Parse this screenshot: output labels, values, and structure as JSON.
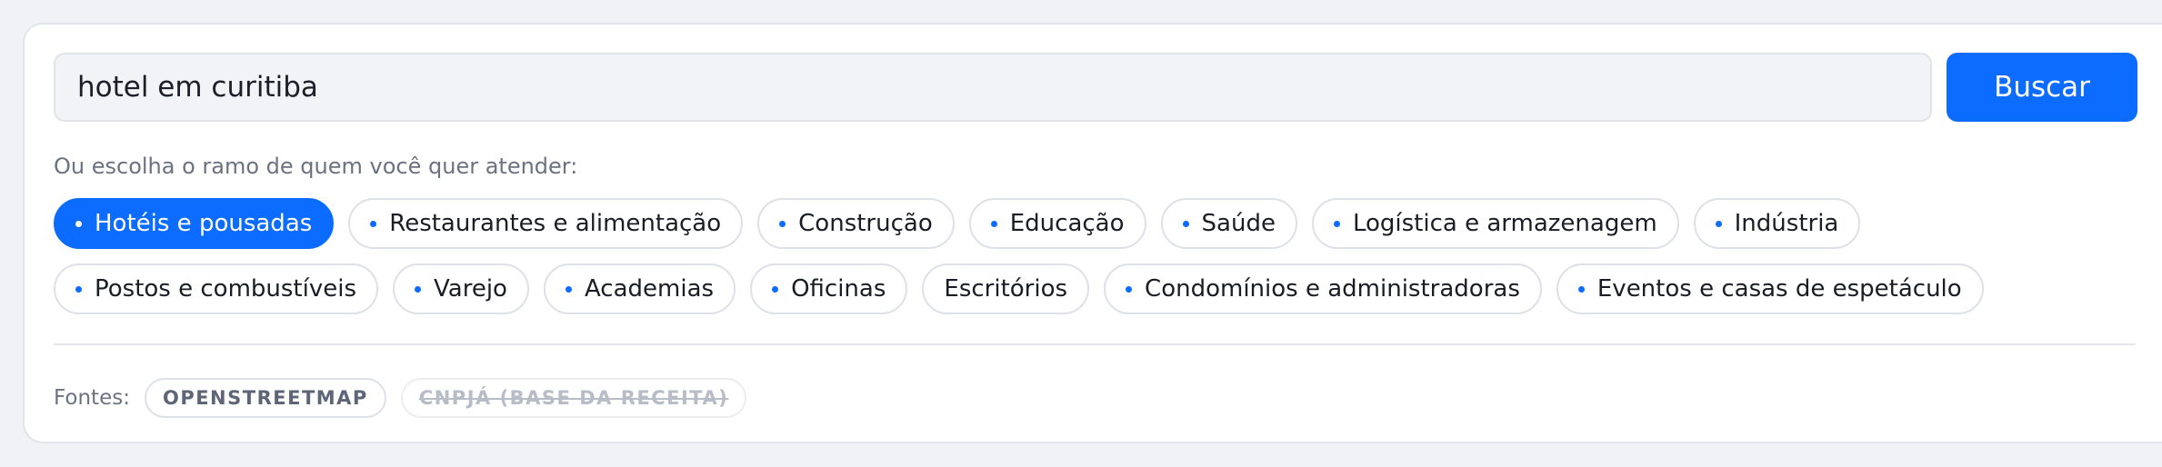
{
  "search": {
    "value": "hotel em curitiba",
    "button_label": "Buscar"
  },
  "branches": {
    "prompt": "Ou escolha o ramo de quem você quer atender:",
    "items": [
      {
        "label": "Hotéis e pousadas",
        "active": true,
        "dot": true
      },
      {
        "label": "Restaurantes e alimentação",
        "active": false,
        "dot": true
      },
      {
        "label": "Construção",
        "active": false,
        "dot": true
      },
      {
        "label": "Educação",
        "active": false,
        "dot": true
      },
      {
        "label": "Saúde",
        "active": false,
        "dot": true
      },
      {
        "label": "Logística e armazenagem",
        "active": false,
        "dot": true
      },
      {
        "label": "Indústria",
        "active": false,
        "dot": true
      },
      {
        "label": "Postos e combustíveis",
        "active": false,
        "dot": true
      },
      {
        "label": "Varejo",
        "active": false,
        "dot": true
      },
      {
        "label": "Academias",
        "active": false,
        "dot": true
      },
      {
        "label": "Oficinas",
        "active": false,
        "dot": true
      },
      {
        "label": "Escritórios",
        "active": false,
        "dot": false
      },
      {
        "label": "Condomínios e administradoras",
        "active": false,
        "dot": true
      },
      {
        "label": "Eventos e casas de espetáculo",
        "active": false,
        "dot": true
      }
    ]
  },
  "sources": {
    "label": "Fontes:",
    "items": [
      {
        "label": "OPENSTREETMAP",
        "enabled": true
      },
      {
        "label": "CNPJÁ (BASE DA RECEITA)",
        "enabled": false
      }
    ]
  },
  "colors": {
    "accent": "#0b6cff",
    "background": "#f1f2f5"
  }
}
